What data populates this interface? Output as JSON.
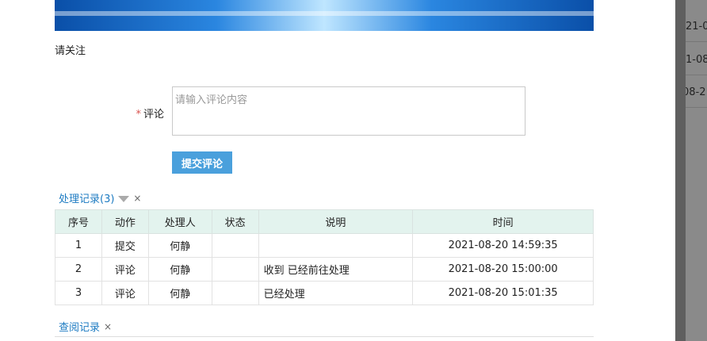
{
  "notice": "请关注",
  "comment": {
    "required_mark": "*",
    "label": "评论",
    "placeholder": "请输入评论内容",
    "submit_label": "提交评论"
  },
  "records_section": {
    "title": "处理记录(3)",
    "close": "×"
  },
  "table": {
    "headers": [
      "序号",
      "动作",
      "处理人",
      "状态",
      "说明",
      "时间"
    ],
    "rows": [
      [
        "1",
        "提交",
        "何静",
        "",
        "",
        "2021-08-20 14:59:35"
      ],
      [
        "2",
        "评论",
        "何静",
        "",
        "收到 已经前往处理",
        "2021-08-20 15:00:00"
      ],
      [
        "3",
        "评论",
        "何静",
        "",
        "已经处理",
        "2021-08-20 15:01:35"
      ]
    ]
  },
  "view_section": {
    "title": "查阅记录",
    "close": "×"
  },
  "background_cells": [
    "21-0",
    "1-08",
    "08-2"
  ]
}
